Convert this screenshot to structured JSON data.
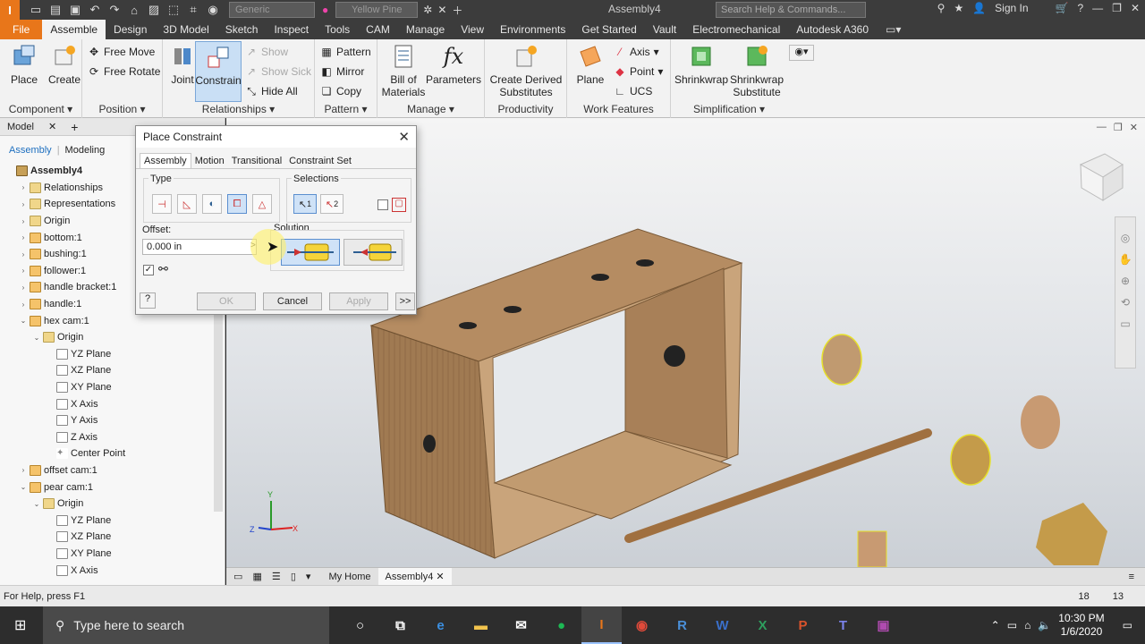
{
  "app": {
    "logo_text": "I",
    "title": "Assembly4",
    "material_dropdown": "Generic",
    "appearance_dropdown": "Yellow Pine",
    "search_placeholder": "Search Help & Commands...",
    "sign_in": "Sign In"
  },
  "menu": {
    "tabs": [
      "File",
      "Assemble",
      "Design",
      "3D Model",
      "Sketch",
      "Inspect",
      "Tools",
      "CAM",
      "Manage",
      "View",
      "Environments",
      "Get Started",
      "Vault",
      "Electromechanical",
      "Autodesk A360"
    ]
  },
  "ribbon": {
    "component": {
      "place": "Place",
      "create": "Create",
      "label": "Component"
    },
    "position": {
      "free_move": "Free Move",
      "free_rotate": "Free Rotate",
      "label": "Position"
    },
    "relationships": {
      "joint": "Joint",
      "constrain": "Constrain",
      "show": "Show",
      "show_sick": "Show Sick",
      "hide_all": "Hide All",
      "label": "Relationships"
    },
    "pattern": {
      "pattern": "Pattern",
      "mirror": "Mirror",
      "copy": "Copy",
      "label": "Pattern"
    },
    "manage": {
      "bom_line1": "Bill of",
      "bom_line2": "Materials",
      "parameters": "Parameters",
      "label": "Manage"
    },
    "productivity": {
      "create_derived_line1": "Create Derived",
      "create_derived_line2": "Substitutes",
      "label": "Productivity"
    },
    "work_features": {
      "plane": "Plane",
      "axis": "Axis",
      "point": "Point",
      "ucs": "UCS",
      "label": "Work Features"
    },
    "simplification": {
      "shrinkwrap": "Shrinkwrap",
      "shrinkwrap_sub_line1": "Shrinkwrap",
      "shrinkwrap_sub_line2": "Substitute",
      "label": "Simplification"
    }
  },
  "browser": {
    "tab": "Model",
    "subtabs": {
      "assembly": "Assembly",
      "modeling": "Modeling"
    },
    "tree": [
      {
        "label": "Assembly4",
        "indent": 0,
        "exp": "",
        "icon": "asm",
        "bold": true
      },
      {
        "label": "Relationships",
        "indent": 1,
        "exp": "▶",
        "icon": "folder"
      },
      {
        "label": "Representations",
        "indent": 1,
        "exp": "▶",
        "icon": "folder"
      },
      {
        "label": "Origin",
        "indent": 1,
        "exp": "▶",
        "icon": "folder"
      },
      {
        "label": "bottom:1",
        "indent": 1,
        "exp": "▶",
        "icon": "part"
      },
      {
        "label": "bushing:1",
        "indent": 1,
        "exp": "▶",
        "icon": "part"
      },
      {
        "label": "follower:1",
        "indent": 1,
        "exp": "▶",
        "icon": "part"
      },
      {
        "label": "handle bracket:1",
        "indent": 1,
        "exp": "▶",
        "icon": "part"
      },
      {
        "label": "handle:1",
        "indent": 1,
        "exp": "▶",
        "icon": "part"
      },
      {
        "label": "hex cam:1",
        "indent": 1,
        "exp": "▼",
        "icon": "part"
      },
      {
        "label": "Origin",
        "indent": 2,
        "exp": "▼",
        "icon": "folder"
      },
      {
        "label": "YZ Plane",
        "indent": 3,
        "exp": "",
        "icon": "plane"
      },
      {
        "label": "XZ Plane",
        "indent": 3,
        "exp": "",
        "icon": "plane"
      },
      {
        "label": "XY Plane",
        "indent": 3,
        "exp": "",
        "icon": "plane"
      },
      {
        "label": "X Axis",
        "indent": 3,
        "exp": "",
        "icon": "plane"
      },
      {
        "label": "Y Axis",
        "indent": 3,
        "exp": "",
        "icon": "plane"
      },
      {
        "label": "Z Axis",
        "indent": 3,
        "exp": "",
        "icon": "plane"
      },
      {
        "label": "Center Point",
        "indent": 3,
        "exp": "",
        "icon": "point"
      },
      {
        "label": "offset cam:1",
        "indent": 1,
        "exp": "▶",
        "icon": "part"
      },
      {
        "label": "pear cam:1",
        "indent": 1,
        "exp": "▼",
        "icon": "part"
      },
      {
        "label": "Origin",
        "indent": 2,
        "exp": "▼",
        "icon": "folder"
      },
      {
        "label": "YZ Plane",
        "indent": 3,
        "exp": "",
        "icon": "plane"
      },
      {
        "label": "XZ Plane",
        "indent": 3,
        "exp": "",
        "icon": "plane"
      },
      {
        "label": "XY Plane",
        "indent": 3,
        "exp": "",
        "icon": "plane"
      },
      {
        "label": "X Axis",
        "indent": 3,
        "exp": "",
        "icon": "plane"
      }
    ]
  },
  "dialog": {
    "title": "Place Constraint",
    "tabs": [
      "Assembly",
      "Motion",
      "Transitional",
      "Constraint Set"
    ],
    "type_label": "Type",
    "selections_label": "Selections",
    "selection_1": "1",
    "selection_2": "2",
    "offset_label": "Offset:",
    "offset_value": "0.000 in",
    "solution_label": "Solution",
    "ok": "OK",
    "cancel": "Cancel",
    "apply": "Apply",
    "more": ">>"
  },
  "viewport": {
    "tabs": {
      "home": "My Home",
      "doc": "Assembly4"
    },
    "axis_labels": {
      "y": "Y",
      "z": "Z",
      "x": "X"
    }
  },
  "status": {
    "help": "For Help, press F1",
    "count_a": "18",
    "count_b": "13"
  },
  "taskbar": {
    "search": "Type here to search",
    "time": "10:30 PM",
    "date": "1/6/2020"
  },
  "colors": {
    "file_tab": "#e8761a",
    "selected_blue": "#cfe2f7",
    "wood": "#a07a52"
  }
}
